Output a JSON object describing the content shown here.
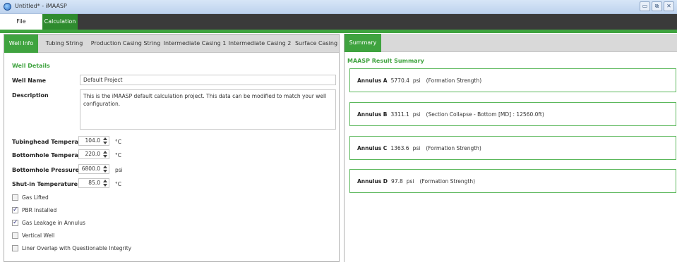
{
  "window": {
    "title": "Untitled* - iMAASP",
    "min_glyph": "▭",
    "max_glyph": "⧉",
    "close_glyph": "✕"
  },
  "menu": {
    "file": "File",
    "calculation": "Calculation"
  },
  "left_tabs": [
    {
      "label": "Well Info",
      "active": true
    },
    {
      "label": "Tubing String",
      "active": false
    },
    {
      "label": "Production Casing String",
      "active": false
    },
    {
      "label": "Intermediate Casing 1",
      "active": false
    },
    {
      "label": "Intermediate Casing 2",
      "active": false
    },
    {
      "label": "Surface Casing",
      "active": false
    }
  ],
  "well_details": {
    "section_title": "Well Details",
    "well_name_label": "Well Name",
    "well_name_value": "Default Project",
    "description_label": "Description",
    "description_value": "This is the iMAASP default calculation project. This data can be modified to match your well configuration.",
    "numeric_fields": [
      {
        "label": "Tubinghead Temperature",
        "value": "104.0",
        "unit": "°C"
      },
      {
        "label": "Bottomhole Temperature",
        "value": "220.0",
        "unit": "°C"
      },
      {
        "label": "Bottomhole Pressure",
        "value": "6800.0",
        "unit": "psi"
      },
      {
        "label": "Shut-in Temperature",
        "value": "85.0",
        "unit": "°C"
      }
    ],
    "checkboxes": [
      {
        "label": "Gas Lifted",
        "checked": false
      },
      {
        "label": "PBR Installed",
        "checked": true
      },
      {
        "label": "Gas Leakage in Annulus",
        "checked": true
      },
      {
        "label": "Vertical Well",
        "checked": false
      },
      {
        "label": "Liner Overlap with Questionable Integrity",
        "checked": false
      }
    ]
  },
  "right_tabs": [
    {
      "label": "Summary",
      "active": true
    }
  ],
  "summary": {
    "section_title": "MAASP Result Summary",
    "results": [
      {
        "annulus": "Annulus A",
        "value": "5770.4",
        "unit": "psi",
        "note": "(Formation Strength)"
      },
      {
        "annulus": "Annulus B",
        "value": "3311.1",
        "unit": "psi",
        "note": "(Section Collapse - Bottom [MD] : 12560.0ft)"
      },
      {
        "annulus": "Annulus C",
        "value": "1363.6",
        "unit": "psi",
        "note": "(Formation Strength)"
      },
      {
        "annulus": "Annulus D",
        "value": "97.8",
        "unit": "psi",
        "note": "(Formation Strength)"
      }
    ]
  },
  "colors": {
    "accent_green": "#3fa33f",
    "menubar_dark": "#3a3a3a"
  }
}
